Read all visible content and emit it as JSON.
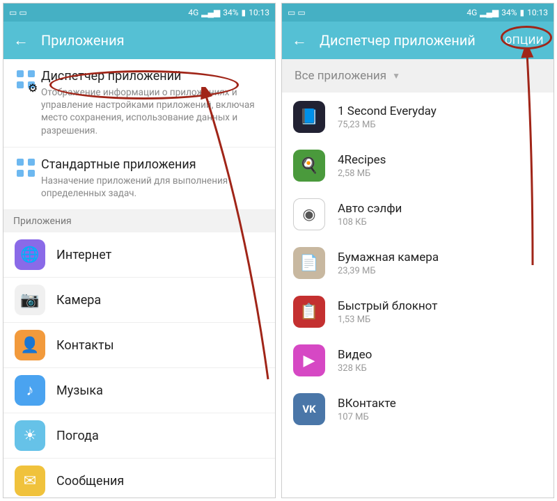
{
  "status": {
    "network": "4G",
    "battery": "34%",
    "time": "10:13"
  },
  "left": {
    "title": "Приложения",
    "pref1": {
      "title": "Диспетчер приложений",
      "sub": "Отображение информации о приложениях и управление настройками приложений, включая место сохранения, использование данных и разрешения."
    },
    "pref2": {
      "title": "Стандартные приложения",
      "sub": "Назначение приложений для выполнения определенных задач."
    },
    "section": "Приложения",
    "apps": [
      {
        "name": "Интернет",
        "color": "#8a6ae8",
        "glyph": "🌐"
      },
      {
        "name": "Камера",
        "color": "#f0f0f0",
        "glyph": "📷"
      },
      {
        "name": "Контакты",
        "color": "#f29a3c",
        "glyph": "👤"
      },
      {
        "name": "Музыка",
        "color": "#4aa3f0",
        "glyph": "♪"
      },
      {
        "name": "Погода",
        "color": "#66c2e8",
        "glyph": "☀"
      },
      {
        "name": "Сообщения",
        "color": "#f0c23c",
        "glyph": "✉"
      }
    ]
  },
  "right": {
    "title": "Диспетчер приложений",
    "options": "ОПЦИИ",
    "filter": "Все приложения",
    "apps": [
      {
        "name": "1 Second Everyday",
        "size": "75,23 МБ",
        "color": "#223",
        "glyph": "📘"
      },
      {
        "name": "4Recipes",
        "size": "2,58 МБ",
        "color": "#4a9a3c",
        "glyph": "🍳"
      },
      {
        "name": "Авто сэлфи",
        "size": "108 КБ",
        "color": "#fff",
        "glyph": "◉"
      },
      {
        "name": "Бумажная камера",
        "size": "23,39 МБ",
        "color": "#c8b8a0",
        "glyph": "📄"
      },
      {
        "name": "Быстрый блокнот",
        "size": "1,53 МБ",
        "color": "#c43030",
        "glyph": "📋"
      },
      {
        "name": "Видео",
        "size": "328 КБ",
        "color": "#d648c4",
        "glyph": "▶"
      },
      {
        "name": "ВКонтакте",
        "size": "107 МБ",
        "color": "#4a76a8",
        "glyph": "VK"
      }
    ]
  }
}
